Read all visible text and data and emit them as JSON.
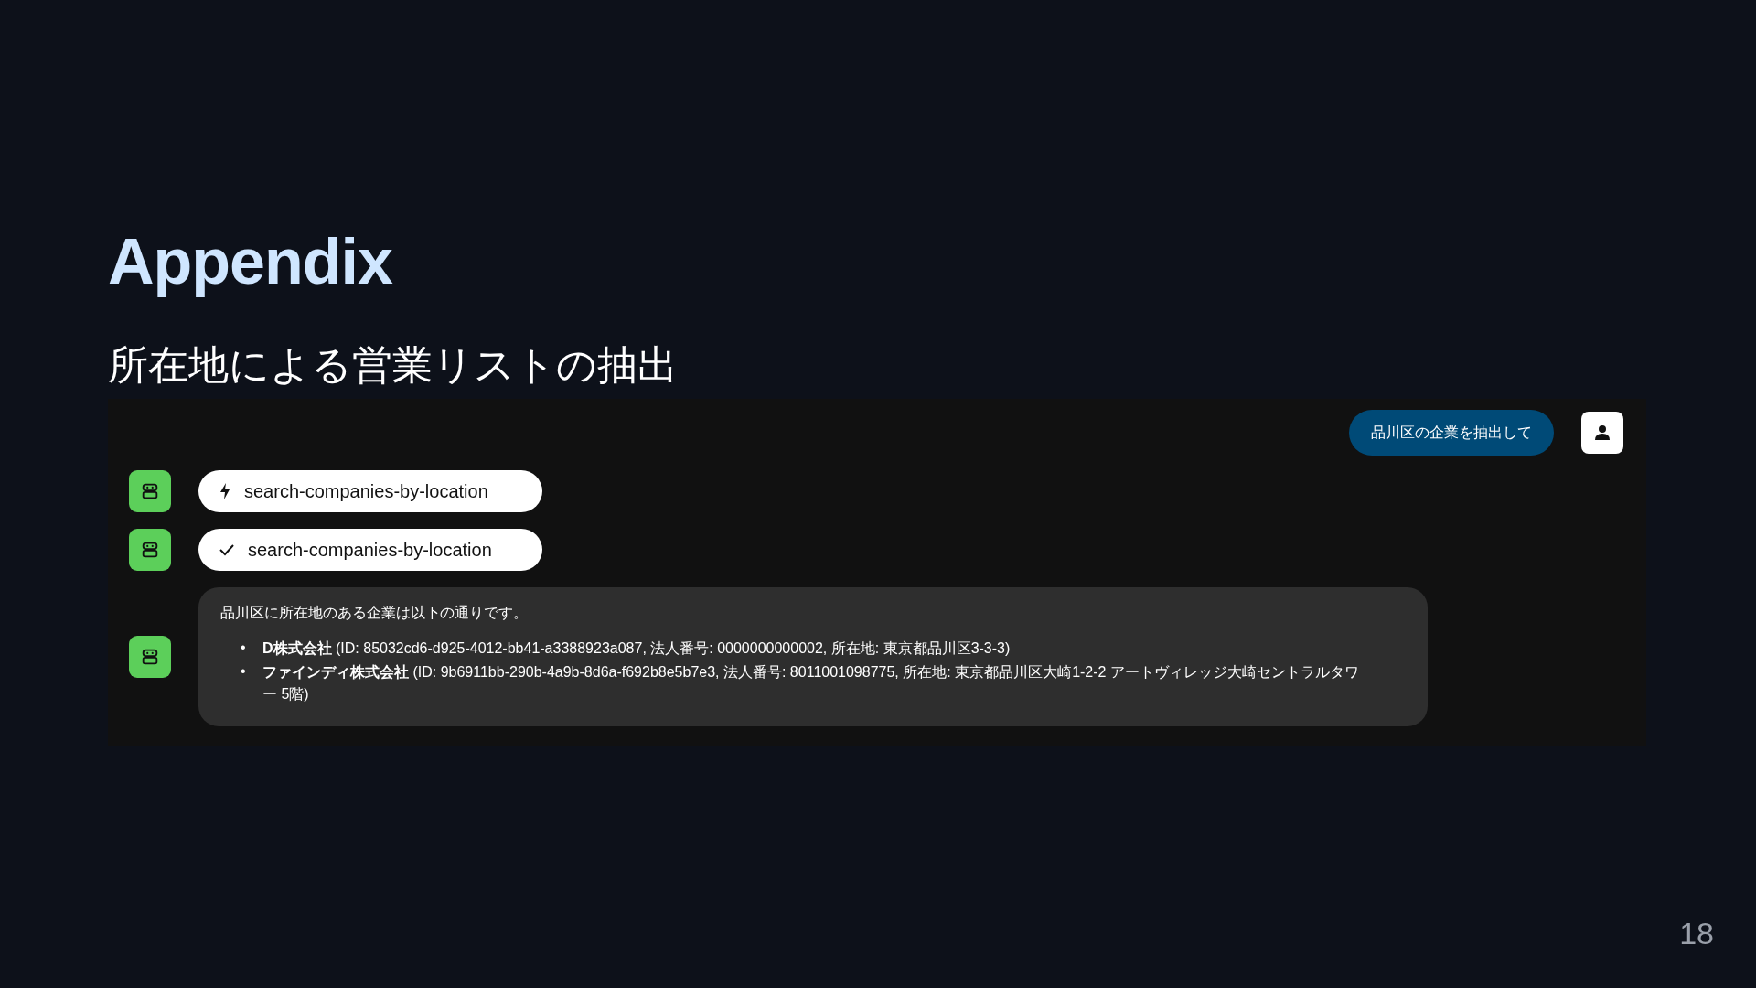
{
  "slide": {
    "title": "Appendix",
    "subtitle": "所在地による営業リストの抽出",
    "page_number": "18"
  },
  "chat": {
    "messages": [
      {
        "kind": "user",
        "text": "品川区の企業を抽出して"
      },
      {
        "kind": "tool",
        "completed": false,
        "text": "search-companies-by-location"
      },
      {
        "kind": "tool",
        "completed": true,
        "text": "search-companies-by-location"
      },
      {
        "kind": "assistant",
        "text": "品川区に所在地のある企業は以下の通りです。",
        "items": [
          {
            "bullet": "•",
            "text": "**D株式会社** (ID: 85032cd6-d925-4012-bb41-a3388923a087, 法人番号: 0000000000002, 所在地: 東京都品川区3-3-3)"
          },
          {
            "bullet": "•",
            "text": "**ファインディ株式会社** (ID: 9b6911bb-290b-4a9b-8d6a-f692b8e5b7e3, 法人番号: 8011001098775, 所在地: 東京都品川区大崎1-2-2 アートヴィレッジ大崎セントラルタワー 5階)"
          }
        ]
      }
    ]
  }
}
